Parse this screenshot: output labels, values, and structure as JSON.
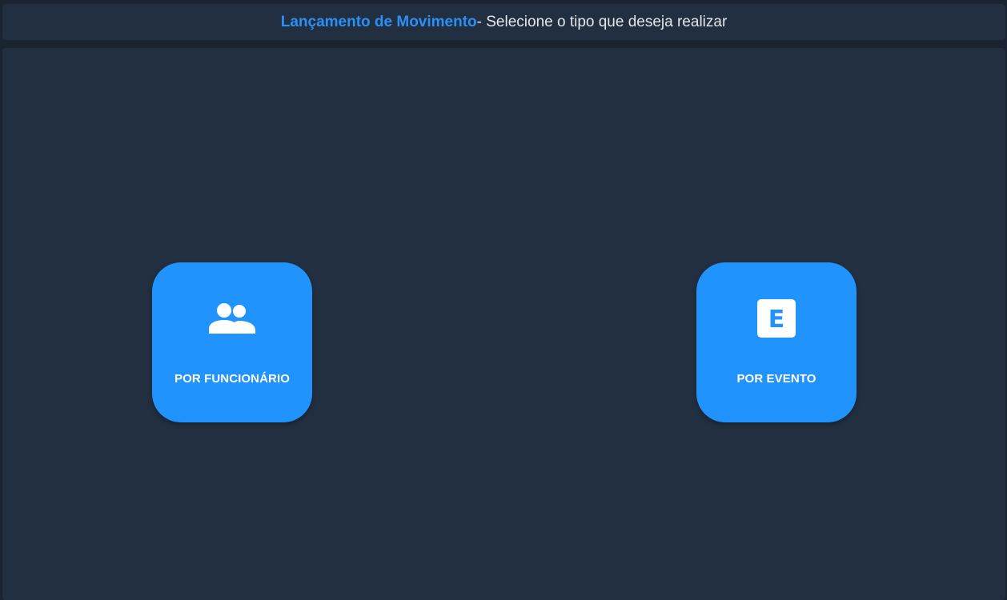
{
  "header": {
    "title_strong": "Lançamento de Movimento",
    "title_rest": "- Selecione o tipo que deseja realizar"
  },
  "options": [
    {
      "label": "POR FUNCIONÁRIO",
      "icon": "people-icon"
    },
    {
      "label": "POR EVENTO",
      "icon": "letter-e-icon",
      "icon_glyph": "E"
    }
  ],
  "colors": {
    "background": "#1a2330",
    "panel": "#212f40",
    "accent": "#2093fd",
    "title_accent": "#2c8ff5",
    "text": "#e3e7ec"
  }
}
